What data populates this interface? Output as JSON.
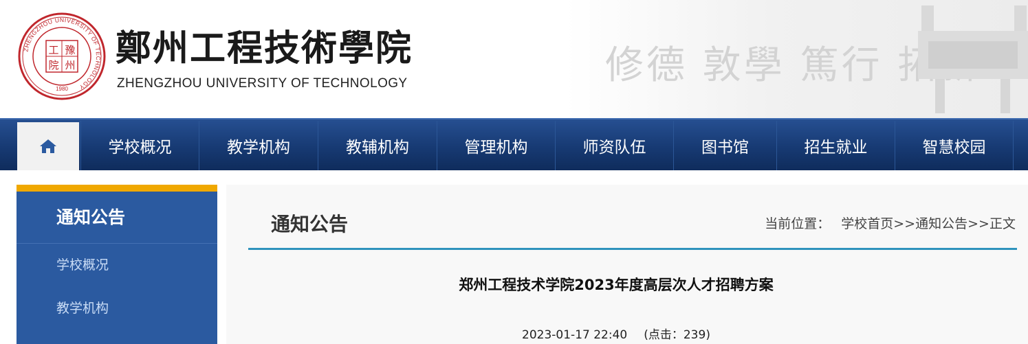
{
  "header": {
    "school_name_cn": "鄭州工程技術學院",
    "school_name_en": "ZHENGZHOU UNIVERSITY OF TECHNOLOGY",
    "motto": "修德 敦學 篤行 拓新",
    "seal": {
      "ring_text": "ZHENGZHOU UNIVERSITY OF TECHNOLOGY",
      "center_text": "工 豫 院 州",
      "year": "1980",
      "color": "#c0272d"
    }
  },
  "nav": {
    "home_icon": "home-icon",
    "items": [
      {
        "label": "学校概况"
      },
      {
        "label": "教学机构"
      },
      {
        "label": "教辅机构"
      },
      {
        "label": "管理机构"
      },
      {
        "label": "师资队伍"
      },
      {
        "label": "图书馆"
      },
      {
        "label": "招生就业"
      },
      {
        "label": "智慧校园"
      }
    ]
  },
  "sidebar": {
    "title": "通知公告",
    "items": [
      {
        "label": "学校概况"
      },
      {
        "label": "教学机构"
      }
    ]
  },
  "main": {
    "title": "通知公告",
    "breadcrumb": {
      "label": "当前位置：",
      "home": "学校首页",
      "sep": ">>",
      "section": "通知公告",
      "current": "正文"
    },
    "article": {
      "title": "郑州工程技术学院2023年度高层次人才招聘方案",
      "date": "2023-01-17 22:40",
      "clicks_label": "(点击：239)"
    }
  },
  "colors": {
    "nav_bg": "#173a73",
    "sidebar_bg": "#2b5aa0",
    "sidebar_accent": "#f0a800",
    "rule": "#2e93bd"
  }
}
